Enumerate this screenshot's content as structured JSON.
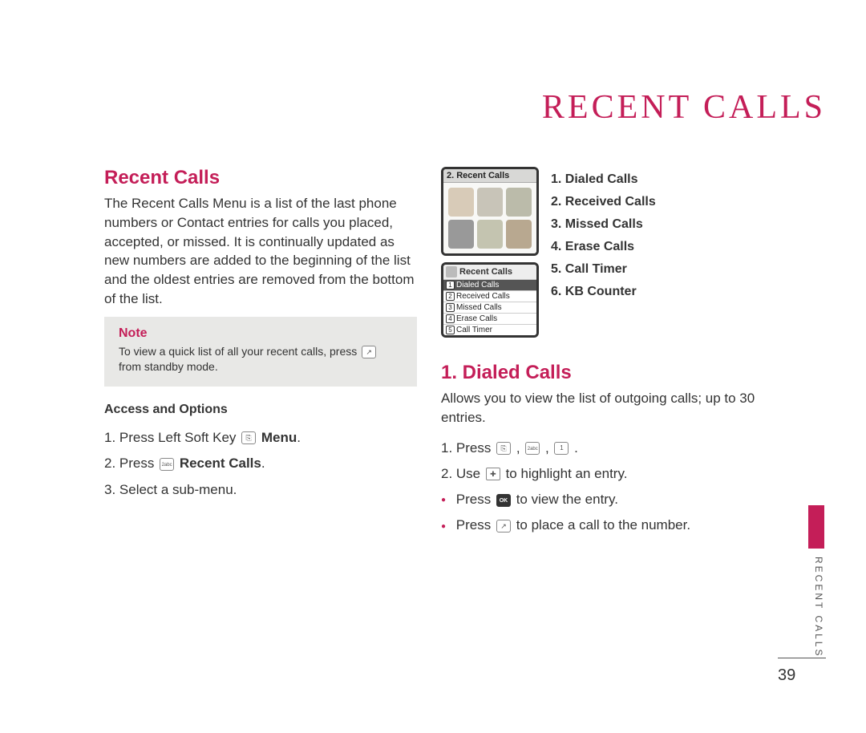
{
  "page_title": "RECENT CALLS",
  "page_number": "39",
  "side_tab": "RECENT CALLS",
  "left": {
    "heading": "Recent Calls",
    "intro": "The Recent Calls Menu is a list of the last phone numbers or Contact entries for calls you placed, accepted, or missed. It is continually updated as new numbers are added to the beginning of the list and the oldest entries are removed from the bottom of the list.",
    "note_title": "Note",
    "note_text_1": "To view a quick list of all your recent calls, press ",
    "note_text_2": " from standby mode.",
    "access_heading": "Access and Options",
    "steps": {
      "s1_a": "1. Press Left Soft Key ",
      "s1_b": " Menu",
      "s1_c": ".",
      "s2_a": "2. Press ",
      "s2_b": " Recent Calls",
      "s2_c": ".",
      "s3": "3. Select a sub-menu."
    }
  },
  "right": {
    "screen1_title": "2. Recent Calls",
    "screen2_title": "Recent Calls",
    "screen2_rows": [
      "Dialed Calls",
      "Received Calls",
      "Missed Calls",
      "Erase Calls",
      "Call Timer"
    ],
    "menu_items": [
      "1. Dialed Calls",
      "2. Received Calls",
      "3. Missed Calls",
      "4. Erase Calls",
      "5. Call Timer",
      "6. KB Counter"
    ],
    "dialed_heading": "1. Dialed Calls",
    "dialed_intro": "Allows you to view the list of outgoing calls; up to 30 entries.",
    "dialed_steps": {
      "s1_a": "1. Press ",
      "s1_b": " , ",
      "s1_c": " , ",
      "s1_d": " .",
      "s2_a": "2.  Use ",
      "s2_b": " to highlight an entry."
    },
    "dialed_bullets": {
      "b1_a": "Press ",
      "b1_b": " to view the entry.",
      "b2_a": "Press ",
      "b2_b": " to place a call to the number."
    }
  }
}
